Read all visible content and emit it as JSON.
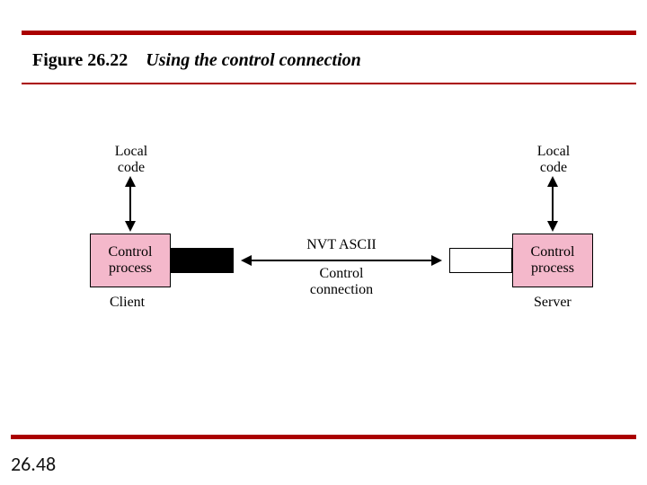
{
  "figure": {
    "number": "Figure 26.22",
    "caption": "Using the control connection"
  },
  "diagram": {
    "left": {
      "local_label": "Local\ncode",
      "box_label": "Control\nprocess",
      "role": "Client"
    },
    "right": {
      "local_label": "Local\ncode",
      "box_label": "Control\nprocess",
      "role": "Server"
    },
    "connection": {
      "top_label": "NVT ASCII",
      "bottom_label": "Control\nconnection"
    }
  },
  "slide_number": "26.48"
}
